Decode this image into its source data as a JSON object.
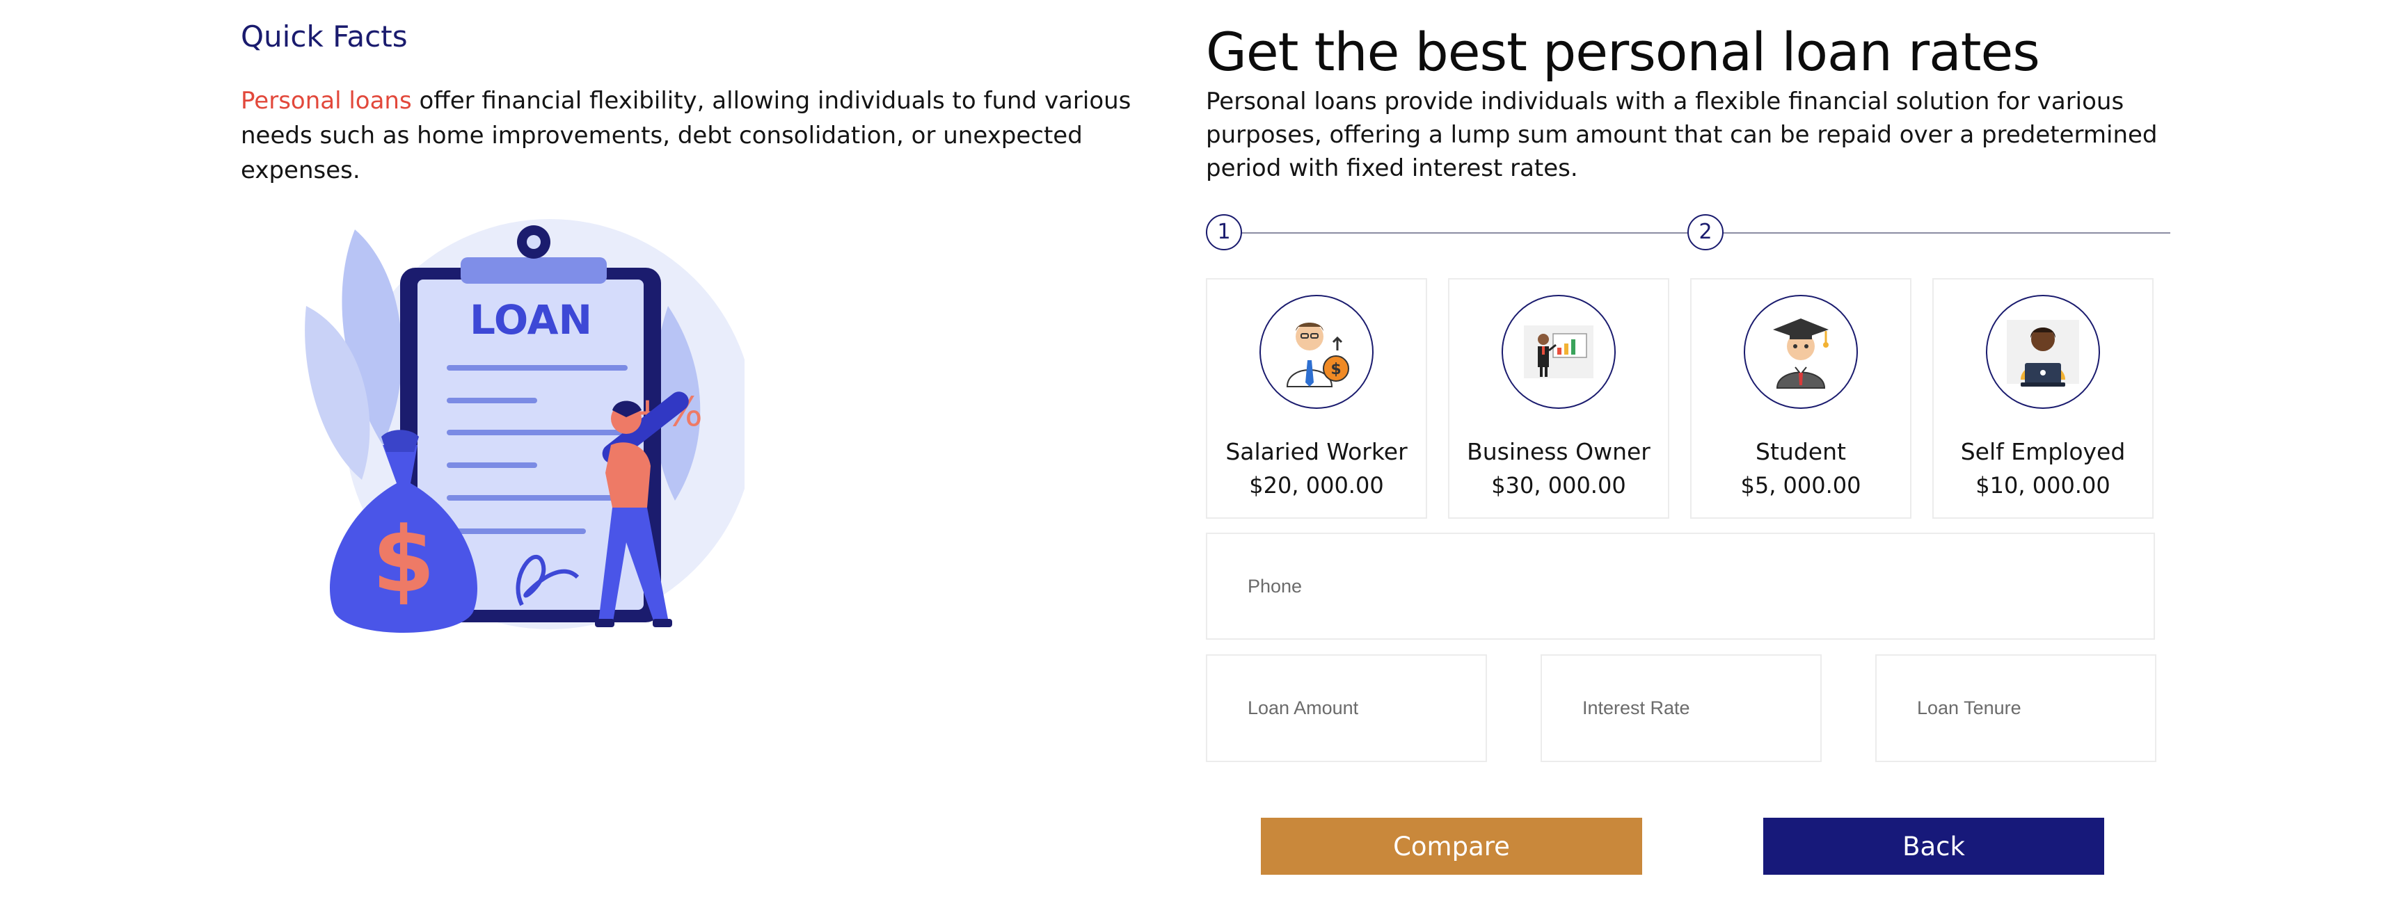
{
  "left": {
    "title": "Quick Facts",
    "highlight": "Personal loans",
    "text": " offer financial flexibility, allowing individuals to fund various needs such as home improvements, debt consolidation, or unexpected expenses.",
    "illustration": {
      "board_text": "LOAN",
      "percent_text": "+%",
      "bag_symbol": "$"
    }
  },
  "right": {
    "title": "Get the best personal loan rates",
    "intro": "Personal loans provide individuals with a flexible financial solution for various purposes, offering a lump sum amount that can be repaid over a predetermined period with fixed interest rates.",
    "steps": [
      "1",
      "2"
    ],
    "cards": [
      {
        "name": "Salaried Worker",
        "amount": "$20, 000.00",
        "icon": "salaried-worker-icon"
      },
      {
        "name": "Business Owner",
        "amount": "$30, 000.00",
        "icon": "business-owner-icon"
      },
      {
        "name": "Student",
        "amount": "$5, 000.00",
        "icon": "student-icon"
      },
      {
        "name": "Self Employed",
        "amount": "$10, 000.00",
        "icon": "self-employed-icon"
      }
    ],
    "form": {
      "phone_placeholder": "Phone",
      "loan_amount_placeholder": "Loan Amount",
      "interest_rate_placeholder": "Interest Rate",
      "loan_tenure_placeholder": "Loan Tenure"
    },
    "buttons": {
      "compare": "Compare",
      "back": "Back"
    }
  },
  "colors": {
    "accent_red": "#e2483b",
    "navy": "#1a1b6e",
    "compare_orange": "#c9883b",
    "back_navy": "#17197a",
    "illustration_blue": "#4a55e8"
  }
}
